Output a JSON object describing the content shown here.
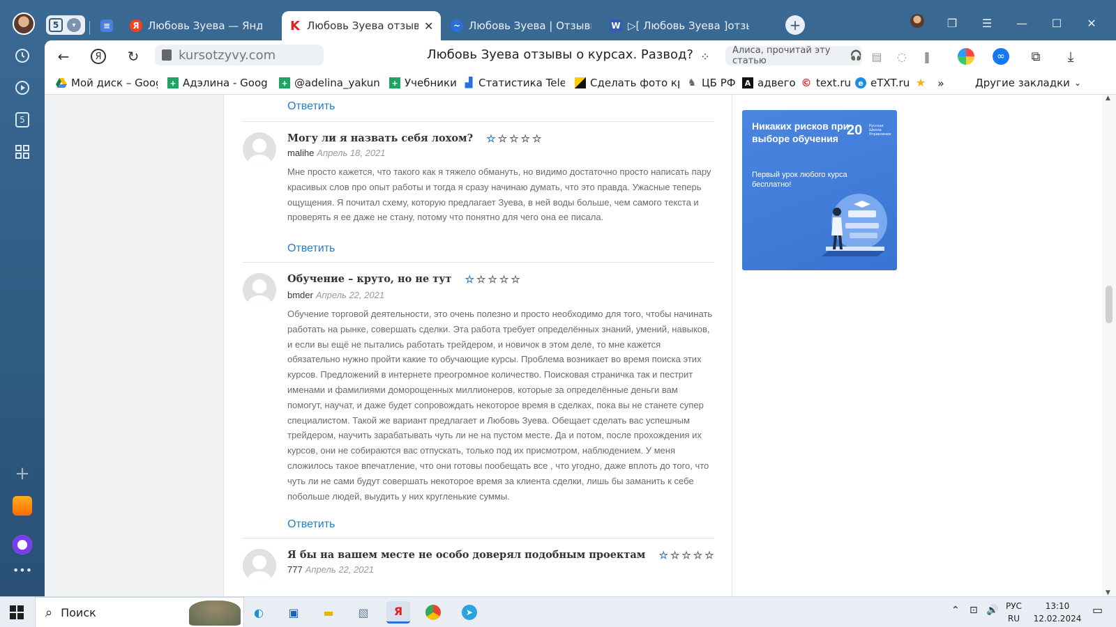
{
  "browser": {
    "tab_count": "5",
    "tabs": [
      {
        "title": "Любовь Зуева — Яндекс:",
        "favicon": "Я"
      },
      {
        "title": "Любовь Зуева отзывы о",
        "favicon": "K"
      },
      {
        "title": "Любовь Зуева | Отзывы л",
        "favicon": "~"
      },
      {
        "title": "▷[ Любовь Зуева ]отзывы",
        "favicon": "W"
      }
    ],
    "domain": "kursotzyvy.com",
    "page_title": "Любовь Зуева отзывы о курсах. Развод?",
    "alice_placeholder": "Алиса, прочитай эту статью"
  },
  "bookmarks": [
    {
      "label": "Мой диск – Googl"
    },
    {
      "label": "Адэлина - Google"
    },
    {
      "label": "@adelina_yakunina"
    },
    {
      "label": "Учебники"
    },
    {
      "label": "Статистика Telegra"
    },
    {
      "label": "Сделать фото круг"
    },
    {
      "label": "ЦБ РФ"
    },
    {
      "label": "адвего"
    },
    {
      "label": "text.ru"
    },
    {
      "label": "eTXT.ru"
    },
    {
      "label": "»"
    },
    {
      "label": "Другие закладки"
    }
  ],
  "reply_label": "Ответить",
  "reviews": [
    {
      "title": "Могу ли я назвать себя лохом?",
      "rating": 1,
      "author": "malihe",
      "date": "Апрель 18, 2021",
      "text": "Мне просто кажется, что такого как я тяжело обмануть, но видимо достаточно просто написать пару красивых слов про опыт работы и тогда я сразу начинаю думать, что это правда. Ужасные теперь ощущения. Я почитал схему, которую предлагает Зуева, в ней воды больше, чем самого текста и проверять я ее даже не стану, потому что понятно для чего она ее писала."
    },
    {
      "title": "Обучение – круто, но не тут",
      "rating": 1,
      "author": "bmder",
      "date": "Апрель 22, 2021",
      "text": "Обучение торговой деятельности, это очень полезно и просто необходимо для того, чтобы начинать работать на рынке, совершать сделки. Эта работа требует определённых знаний, умений, навыков, и если вы ещё не пытались работать трейдером, и новичок в этом деле, то мне кажется обязательно нужно пройти какие то обучающие курсы. Проблема возникает во время поиска этих курсов. Предложений в интернете преогромное количество. Поисковая страничка так и пестрит именами и фамилиями доморощенных миллионеров, которые за определённые деньги вам помогут, научат, и даже будет сопровождать некоторое время в сделках, пока вы не станете супер специалистом. Такой же вариант предлагает и Любовь Зуева. Обещает сделать вас успешным трейдером, научить зарабатывать чуть ли не на пустом месте. Да и потом, после прохождения их курсов, они не собираются вас отпускать, только под их присмотром, наблюдением. У меня сложилось такое впечатление, что они готовы пообещать все , что угодно, даже вплоть до того, что чуть ли не сами будут совершать некоторое время за клиента сделки, лишь бы заманить к себе побольше людей, выудить у них кругленькие суммы."
    },
    {
      "title": "Я бы на вашем месте не особо доверял подобным проектам",
      "rating": 1,
      "author": "777",
      "date": "Апрель 22, 2021"
    }
  ],
  "ad": {
    "headline": "Никаких рисков при выборе обучения",
    "subtext": "Первый урок любого курса бесплатно!",
    "logo": "20",
    "logo_sub": "Русская Школа Управления"
  },
  "taskbar": {
    "search_label": "Поиск",
    "lang_top": "РУС",
    "lang_bottom": "RU",
    "time": "13:10",
    "date": "12.02.2024"
  }
}
